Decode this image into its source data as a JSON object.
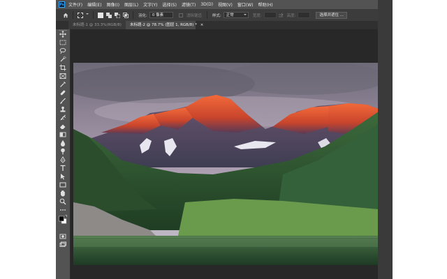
{
  "app": {
    "logo_text": "Ps",
    "menu": [
      "文件(F)",
      "编辑(E)",
      "图像(I)",
      "图层(L)",
      "文字(Y)",
      "选择(S)",
      "滤镜(T)",
      "3D(D)",
      "视图(V)",
      "窗口(W)",
      "帮助(H)"
    ]
  },
  "options_bar": {
    "feather_label": "羽化:",
    "feather_value": "0 像素",
    "antialias_label": "消除锯齿",
    "style_label": "样式:",
    "style_value": "正常",
    "width_label": "宽度:",
    "height_label": "高度:",
    "select_mask_button": "选择并遮住 ..."
  },
  "tabs": [
    {
      "label": "未标题-1 @ 33.3%(RGB/8)",
      "close": "×",
      "active": false
    },
    {
      "label": "未标题-2 @ 78.7% (图层 1, RGB/8) *",
      "close": "×",
      "active": true
    }
  ],
  "tools": [
    "move-tool-icon",
    "rectangular-marquee-icon",
    "lasso-icon",
    "quick-selection-icon",
    "crop-icon",
    "frame-icon",
    "eyedropper-icon",
    "healing-brush-icon",
    "brush-icon",
    "clone-stamp-icon",
    "history-brush-icon",
    "eraser-icon",
    "gradient-icon",
    "blur-icon",
    "dodge-icon",
    "pen-icon",
    "type-icon",
    "path-selection-icon",
    "rectangle-shape-icon",
    "hand-icon",
    "zoom-icon",
    "more-tools-icon",
    "color-swatches-icon",
    "quick-mask-icon",
    "screen-mode-icon"
  ],
  "colors": {
    "workspace": "#282828",
    "chrome": "#535353",
    "options_bar": "#3c3c3c",
    "foreground_color": "#000000",
    "background_color": "#ffffff",
    "logo_accent": "#31a8ff"
  }
}
